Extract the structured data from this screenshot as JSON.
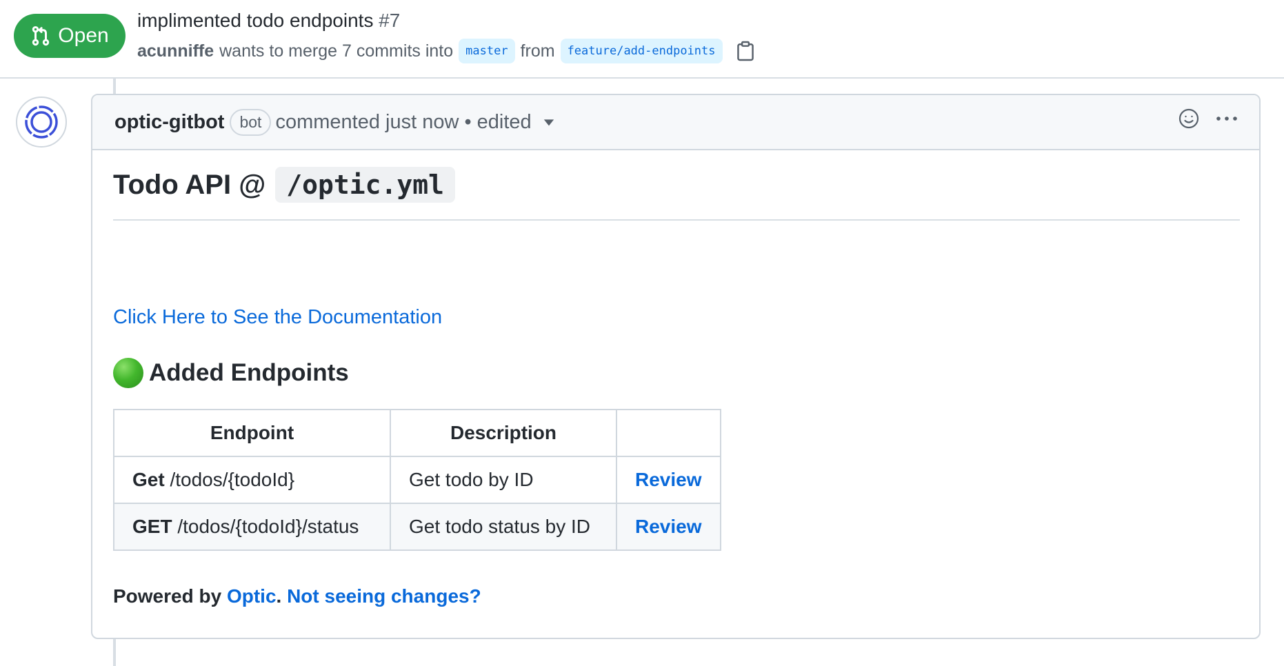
{
  "pr": {
    "state": "Open",
    "title": "implimented todo endpoints",
    "number": "#7",
    "author": "acunniffe",
    "merge_text": "wants to merge 7 commits into",
    "base_branch": "master",
    "from_text": "from",
    "head_branch": "feature/add-endpoints",
    "state_color": "#2da44e"
  },
  "comment": {
    "author": "optic-gitbot",
    "bot_label": "bot",
    "meta": "commented just now • edited",
    "heading_text": "Todo API @",
    "heading_code": "/optic.yml",
    "doc_link": "Click Here to See the Documentation",
    "section_title": "Added Endpoints",
    "table": {
      "headers": [
        "Endpoint",
        "Description",
        ""
      ],
      "rows": [
        {
          "method": "Get",
          "path": "/todos/{todoId}",
          "description": "Get todo by ID",
          "action": "Review"
        },
        {
          "method": "GET",
          "path": "/todos/{todoId}/status",
          "description": "Get todo status by ID",
          "action": "Review"
        }
      ]
    },
    "footer": {
      "prefix": "Powered by",
      "optic_link": "Optic",
      "period": ".",
      "help_link": "Not seeing changes?"
    }
  },
  "icons": {
    "state": "git-pull-request-icon",
    "copy": "clipboard-icon",
    "avatar": "optic-logo-icon",
    "caret": "triangle-down-icon",
    "reaction": "smiley-icon",
    "more": "kebab-horizontal-icon",
    "status": "green-circle-icon"
  },
  "colors": {
    "link": "#0969da",
    "branch_bg": "#ddf4ff",
    "border": "#d0d7de",
    "header_bg": "#f6f8fa"
  }
}
